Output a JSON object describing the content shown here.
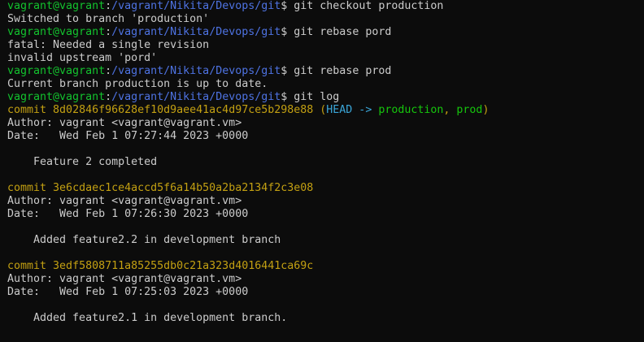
{
  "prompt": {
    "user": "vagrant@vagrant",
    "sep": ":",
    "path": "/vagrant/Nikita/Devops/git",
    "symbol": "$"
  },
  "lines": [
    {
      "kind": "prompt",
      "cmd": " git checkout production"
    },
    {
      "kind": "output",
      "text": "Switched to branch 'production'"
    },
    {
      "kind": "prompt",
      "cmd": " git rebase pord"
    },
    {
      "kind": "output",
      "text": "fatal: Needed a single revision"
    },
    {
      "kind": "output",
      "text": "invalid upstream 'pord'"
    },
    {
      "kind": "prompt",
      "cmd": " git rebase prod"
    },
    {
      "kind": "output",
      "text": "Current branch production is up to date."
    },
    {
      "kind": "prompt",
      "cmd": " git log"
    }
  ],
  "commits": [
    {
      "commit_label": "commit ",
      "hash": "8d02846f96628ef10d9aee41ac4d97ce5b298e88",
      "refs": {
        "open": " (",
        "head": "HEAD -> ",
        "branch": "production",
        "comma": ", ",
        "other": "prod",
        "close": ")"
      },
      "author": "Author: vagrant <vagrant@vagrant.vm>",
      "date": "Date:   Wed Feb 1 07:27:44 2023 +0000",
      "message": "    Feature 2 completed"
    },
    {
      "commit_label": "commit ",
      "hash": "3e6cdaec1ce4accd5f6a14b50a2ba2134f2c3e08",
      "author": "Author: vagrant <vagrant@vagrant.vm>",
      "date": "Date:   Wed Feb 1 07:26:30 2023 +0000",
      "message": "    Added feature2.2 in development branch"
    },
    {
      "commit_label": "commit ",
      "hash": "3edf5808711a85255db0c21a323d4016441ca69c",
      "author": "Author: vagrant <vagrant@vagrant.vm>",
      "date": "Date:   Wed Feb 1 07:25:03 2023 +0000",
      "message": "    Added feature2.1 in development branch."
    }
  ],
  "colors": {
    "background": "#0c0c0c",
    "prompt_user": "#13c32e",
    "prompt_path": "#4e73e3",
    "commit_hash": "#c3a012",
    "head_ref": "#3aa6d8",
    "branch_ref": "#16c60c",
    "text": "#cccccc"
  }
}
